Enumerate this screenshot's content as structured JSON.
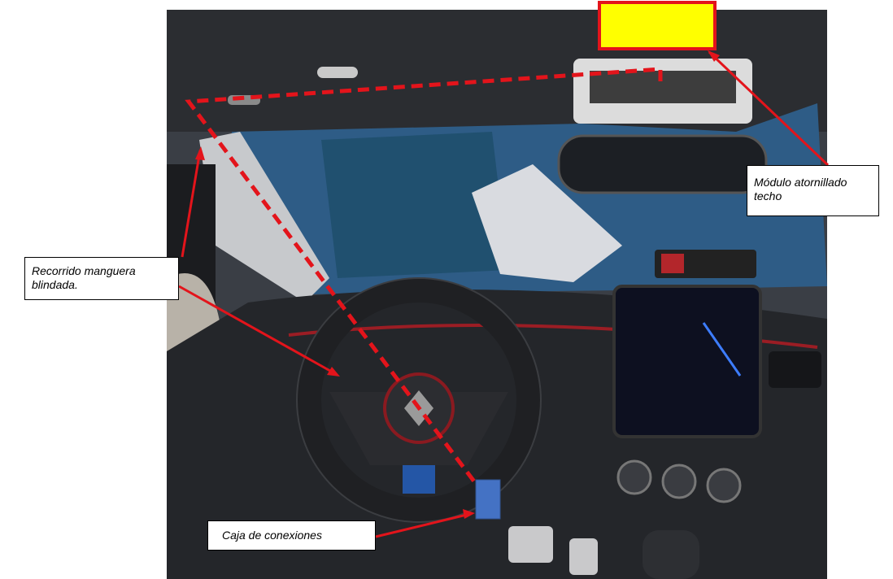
{
  "callouts": {
    "roof_module": "Módulo atornillado techo",
    "armored_hose_route": "Recorrido manguera blindada.",
    "junction_box": "Caja de conexiones"
  },
  "colors": {
    "route_line": "#e3141b",
    "roof_module_fill": "#ffff00",
    "roof_module_border": "#e3141b",
    "junction_box_fill": "#4472c4",
    "callout_border": "#000000"
  },
  "icons": [
    "renault-logo-icon"
  ]
}
